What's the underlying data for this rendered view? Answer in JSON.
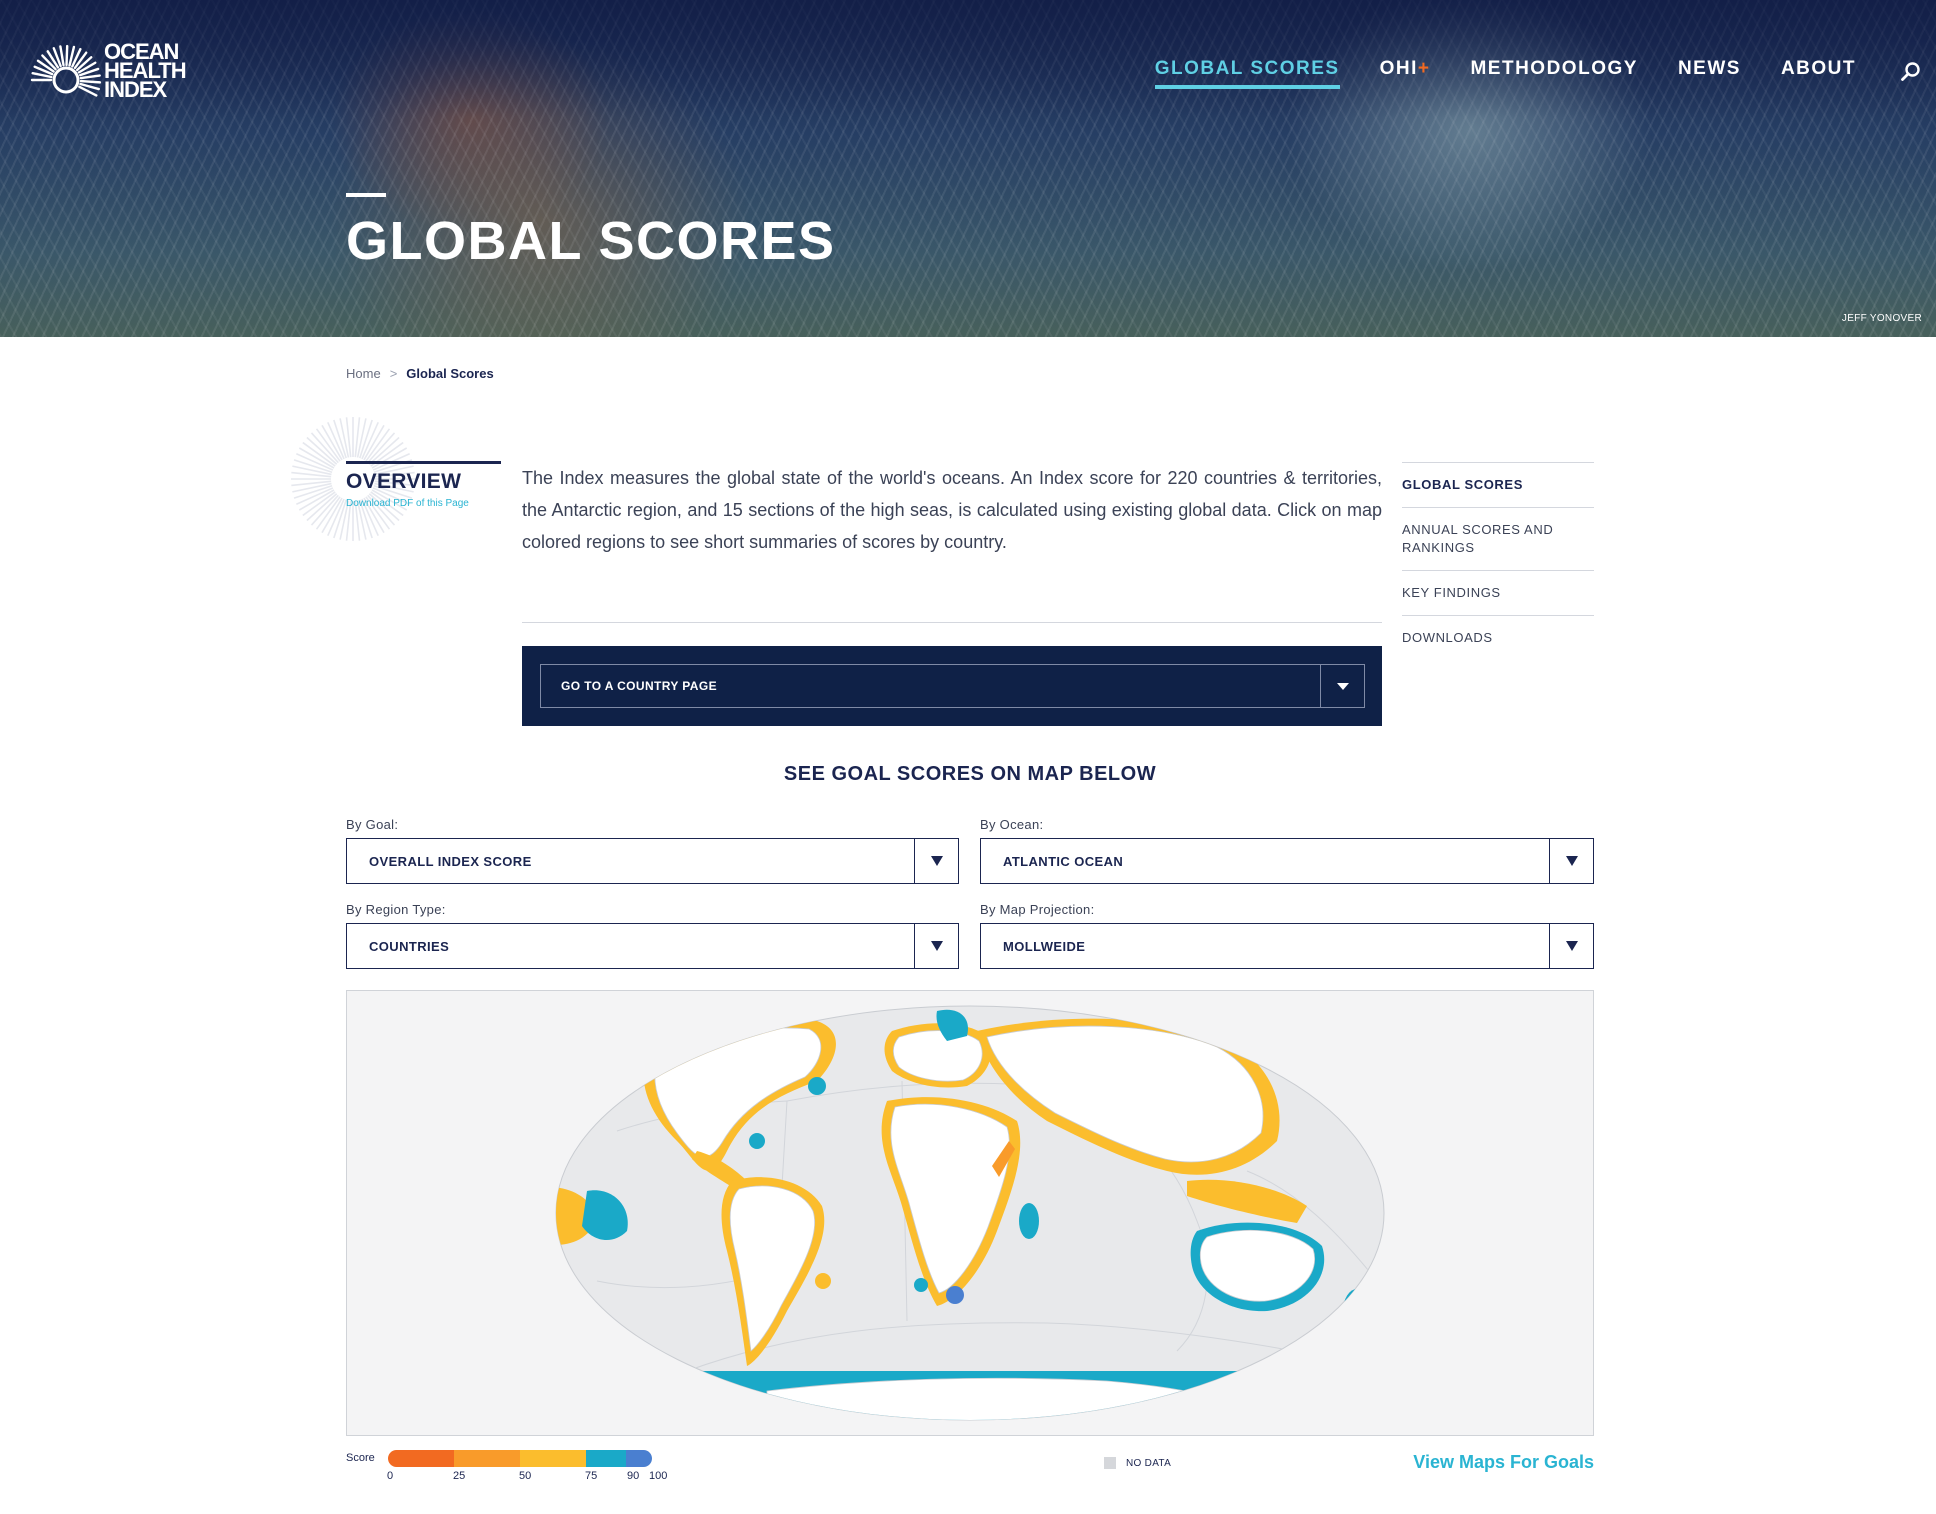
{
  "logo": {
    "line1": "OCEAN",
    "line2": "HEALTH",
    "line3": "INDEX"
  },
  "nav": {
    "items": [
      {
        "label": "GLOBAL SCORES",
        "active": true
      },
      {
        "label": "OHI",
        "suffix": "+"
      },
      {
        "label": "METHODOLOGY"
      },
      {
        "label": "NEWS"
      },
      {
        "label": "ABOUT"
      }
    ],
    "search_icon": "search-icon"
  },
  "hero": {
    "title": "GLOBAL SCORES",
    "credit": "JEFF YONOVER"
  },
  "breadcrumb": {
    "home": "Home",
    "separator": ">",
    "current": "Global Scores"
  },
  "overview": {
    "heading": "OVERVIEW",
    "pdf_link": "Download PDF of this Page",
    "intro": "The Index measures the global state of the world's oceans. An Index score for 220 countries & territories, the Antarctic region, and 15 sections of the high seas, is calculated using existing global data. Click on map colored regions to see short summaries of scores by country."
  },
  "sidenav": {
    "items": [
      "GLOBAL SCORES",
      "ANNUAL SCORES AND RANKINGS",
      "KEY FINDINGS",
      "DOWNLOADS"
    ]
  },
  "country_page": {
    "label": "GO TO A COUNTRY PAGE"
  },
  "see_goals": "SEE GOAL SCORES ON MAP BELOW",
  "filters": {
    "goal": {
      "label": "By Goal:",
      "value": "OVERALL INDEX SCORE"
    },
    "ocean": {
      "label": "By Ocean:",
      "value": "ATLANTIC OCEAN"
    },
    "region_type": {
      "label": "By Region Type:",
      "value": "COUNTRIES"
    },
    "projection": {
      "label": "By Map Projection:",
      "value": "MOLLWEIDE"
    }
  },
  "legend": {
    "title": "Score",
    "ticks": [
      "0",
      "25",
      "50",
      "75",
      "90",
      "100"
    ],
    "no_data": "NO DATA",
    "view_maps": "View Maps For Goals"
  },
  "colors": {
    "navy": "#1b2550",
    "teal": "#2ab4d2",
    "score_0_25": "#f26a21",
    "score_25_50": "#f99b2a",
    "score_50_75": "#fbbd2d",
    "score_75_90": "#1aa9c8",
    "score_90_100": "#4a7fd0",
    "no_data": "#d5d7db"
  }
}
